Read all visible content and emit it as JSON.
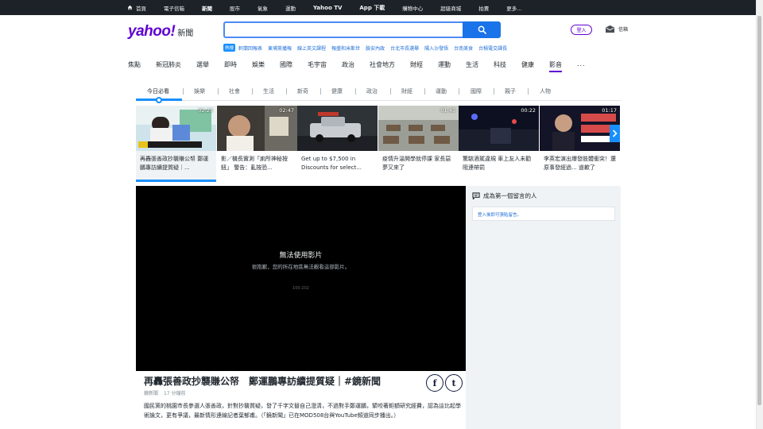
{
  "topbar": {
    "items": [
      {
        "label": "首頁"
      },
      {
        "label": "電子信箱"
      },
      {
        "label": "新聞"
      },
      {
        "label": "股市"
      },
      {
        "label": "氣象"
      },
      {
        "label": "運動"
      },
      {
        "label": "Yahoo TV"
      },
      {
        "label": "App 下載"
      },
      {
        "label": "購物中心"
      },
      {
        "label": "超級商城"
      },
      {
        "label": "拍賣"
      },
      {
        "label": "更多..."
      }
    ]
  },
  "header": {
    "logo": "yahoo!",
    "logo_sub": "新聞",
    "search_value": "",
    "trend_badge": "熱搜",
    "trends": [
      "軒蘭回報表",
      "東埔黨播報",
      "線上英文課程",
      "報盛和米斯世",
      "臉安內政",
      "台北市長選舉",
      "陽入沙發悟",
      "台南美食",
      "台積電交課長"
    ],
    "login": "登入",
    "mail": "信箱"
  },
  "mainnav": {
    "items": [
      "焦點",
      "新冠肺炎",
      "選舉",
      "即時",
      "娛樂",
      "國際",
      "毛宇宙",
      "政治",
      "社會地方",
      "財經",
      "運動",
      "生活",
      "科技",
      "健康",
      "影音"
    ],
    "active": "影音",
    "more": "..."
  },
  "subnav": {
    "items": [
      "今日必看",
      "娛樂",
      "社會",
      "生活",
      "新奇",
      "健康",
      "政治",
      "財經",
      "運動",
      "國際",
      "親子",
      "人物"
    ]
  },
  "videos": [
    {
      "duration": "02:25",
      "title": "再轟張善政抄襲賺公帑 鄭運鵬專訪續提質疑｜..."
    },
    {
      "duration": "02:47",
      "title": "影／機長實測「廁所神秘按鈕」 警告：亂按恐..."
    },
    {
      "duration": "",
      "title": "Get up to $7,500 in Discounts for select..."
    },
    {
      "duration": "01:45",
      "title": "疫情升溫開學就停課 家長惡夢又來了"
    },
    {
      "duration": "00:22",
      "title": "驚駭酒駕違規 車上友人未勸阻連帶罰"
    },
    {
      "duration": "01:17",
      "title": "李英宏演出爆發肢體衝突！還原事發經過... 道歉了"
    }
  ],
  "player": {
    "message": "無法使用影片",
    "sub": "很抱歉，您的所在地區無法觀看這部影片。",
    "code": "100-202"
  },
  "article": {
    "title": "再轟張善政抄襲賺公帑　鄭運鵬專訪續提質疑｜#鏡新聞",
    "source": "鏡新聞",
    "time": "17 分鐘前",
    "description": "國民黨的桃園市長參選人張善政，針對抄襲質疑，發了千字文替自己澄清，不過對手鄭運鵬，緊咬著鉅額研究經費，認為這比起學術論文，更有爭議，最新情形連線記者葉郁甫。（「鏡新聞」已在MOD508台與YouTube頻道同步播出。）"
  },
  "comments": {
    "heading": "成為第一個留言的人",
    "login_prompt": "登入後即可張貼留言。"
  },
  "colors": {
    "brand": "#6001d2",
    "accent": "#188fff",
    "topbar": "#1d2228"
  }
}
